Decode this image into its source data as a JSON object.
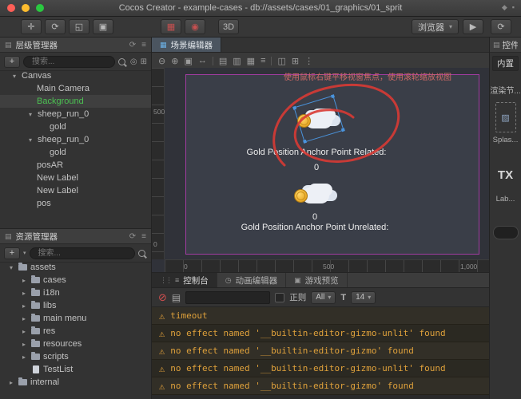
{
  "window": {
    "title": "Cocos Creator - example-cases - db://assets/cases/01_graphics/01_sprit"
  },
  "colors": {
    "warning": "#e0a23c",
    "selected_green": "#4cc052",
    "design_border": "#a03ca0",
    "annotation_red": "#d83a34",
    "tab_active": "#4b5560"
  },
  "icons": {
    "move": "✛",
    "rotate": "⟳",
    "scale": "◱",
    "rect": "▣",
    "scene_red": "▦",
    "record_red": "◉",
    "play": "▶",
    "refresh": "⟳",
    "dropdown": "▾",
    "panel": "▤",
    "menu": "≡",
    "warning": "⚠",
    "clear": "⊘",
    "doc": "▤",
    "font_size": "T",
    "console_tab": "≡",
    "animation_tab": "◷",
    "preview_tab": "▣",
    "scene_tab": "▦",
    "locate": "◎",
    "expand": "⊞",
    "arrow_expanded": "▾",
    "arrow_collapsed": "▸",
    "plus": "+",
    "grip": "⋮⋮",
    "sprite": "▨",
    "titlebar_extra_1": "◆",
    "titlebar_extra_2": "▪"
  },
  "toolbar": {
    "mode_3d": "3D",
    "browser": "浏览器"
  },
  "hierarchy": {
    "title": "层级管理器",
    "search_placeholder": "搜索...",
    "items": [
      {
        "label": "Canvas"
      },
      {
        "label": "Main Camera"
      },
      {
        "label": "Background"
      },
      {
        "label": "sheep_run_0"
      },
      {
        "label": "gold"
      },
      {
        "label": "sheep_run_0"
      },
      {
        "label": "gold"
      },
      {
        "label": "posAR"
      },
      {
        "label": "New Label"
      },
      {
        "label": "New Label"
      },
      {
        "label": "pos"
      }
    ]
  },
  "assets": {
    "title": "资源管理器",
    "search_placeholder": "搜索...",
    "items": [
      {
        "label": "assets"
      },
      {
        "label": "cases"
      },
      {
        "label": "i18n"
      },
      {
        "label": "libs"
      },
      {
        "label": "main menu"
      },
      {
        "label": "res"
      },
      {
        "label": "resources"
      },
      {
        "label": "scripts"
      },
      {
        "label": "TestList"
      },
      {
        "label": "internal"
      }
    ]
  },
  "scene": {
    "tab": "场景编辑器",
    "toolbar_icons": [
      "⊖",
      "⊕",
      "▣",
      "↔",
      "▤",
      "▥",
      "▦",
      "≡",
      "◫",
      "⊞",
      "⋮"
    ],
    "hint": "使用鼠标右键平移视窗焦点，使用滚轮缩放视图",
    "label_related": "Gold Position Anchor Point Related:",
    "value_related": "0",
    "label_unrelated": "Gold Position Anchor Point Unrelated:",
    "value_unrelated": "0",
    "ruler_left": [
      "500",
      "0"
    ],
    "ruler_bottom": [
      "0",
      "500",
      "1,000"
    ]
  },
  "console": {
    "tabs": [
      "控制台",
      "动画编辑器",
      "游戏预览"
    ],
    "regex_label": "正则",
    "filter_all": "All",
    "font_size_value": "14",
    "logs": [
      "timeout",
      "no effect named '__builtin-editor-gizmo-unlit' found",
      "no effect named '__builtin-editor-gizmo' found",
      "no effect named '__builtin-editor-gizmo-unlit' found",
      "no effect named '__builtin-editor-gizmo' found"
    ]
  },
  "library": {
    "title": "控件库",
    "tab_builtin": "内置",
    "section": "渲染节...",
    "item_sprite": "Splas...",
    "item_tx": "TX",
    "item_label": "Lab..."
  }
}
